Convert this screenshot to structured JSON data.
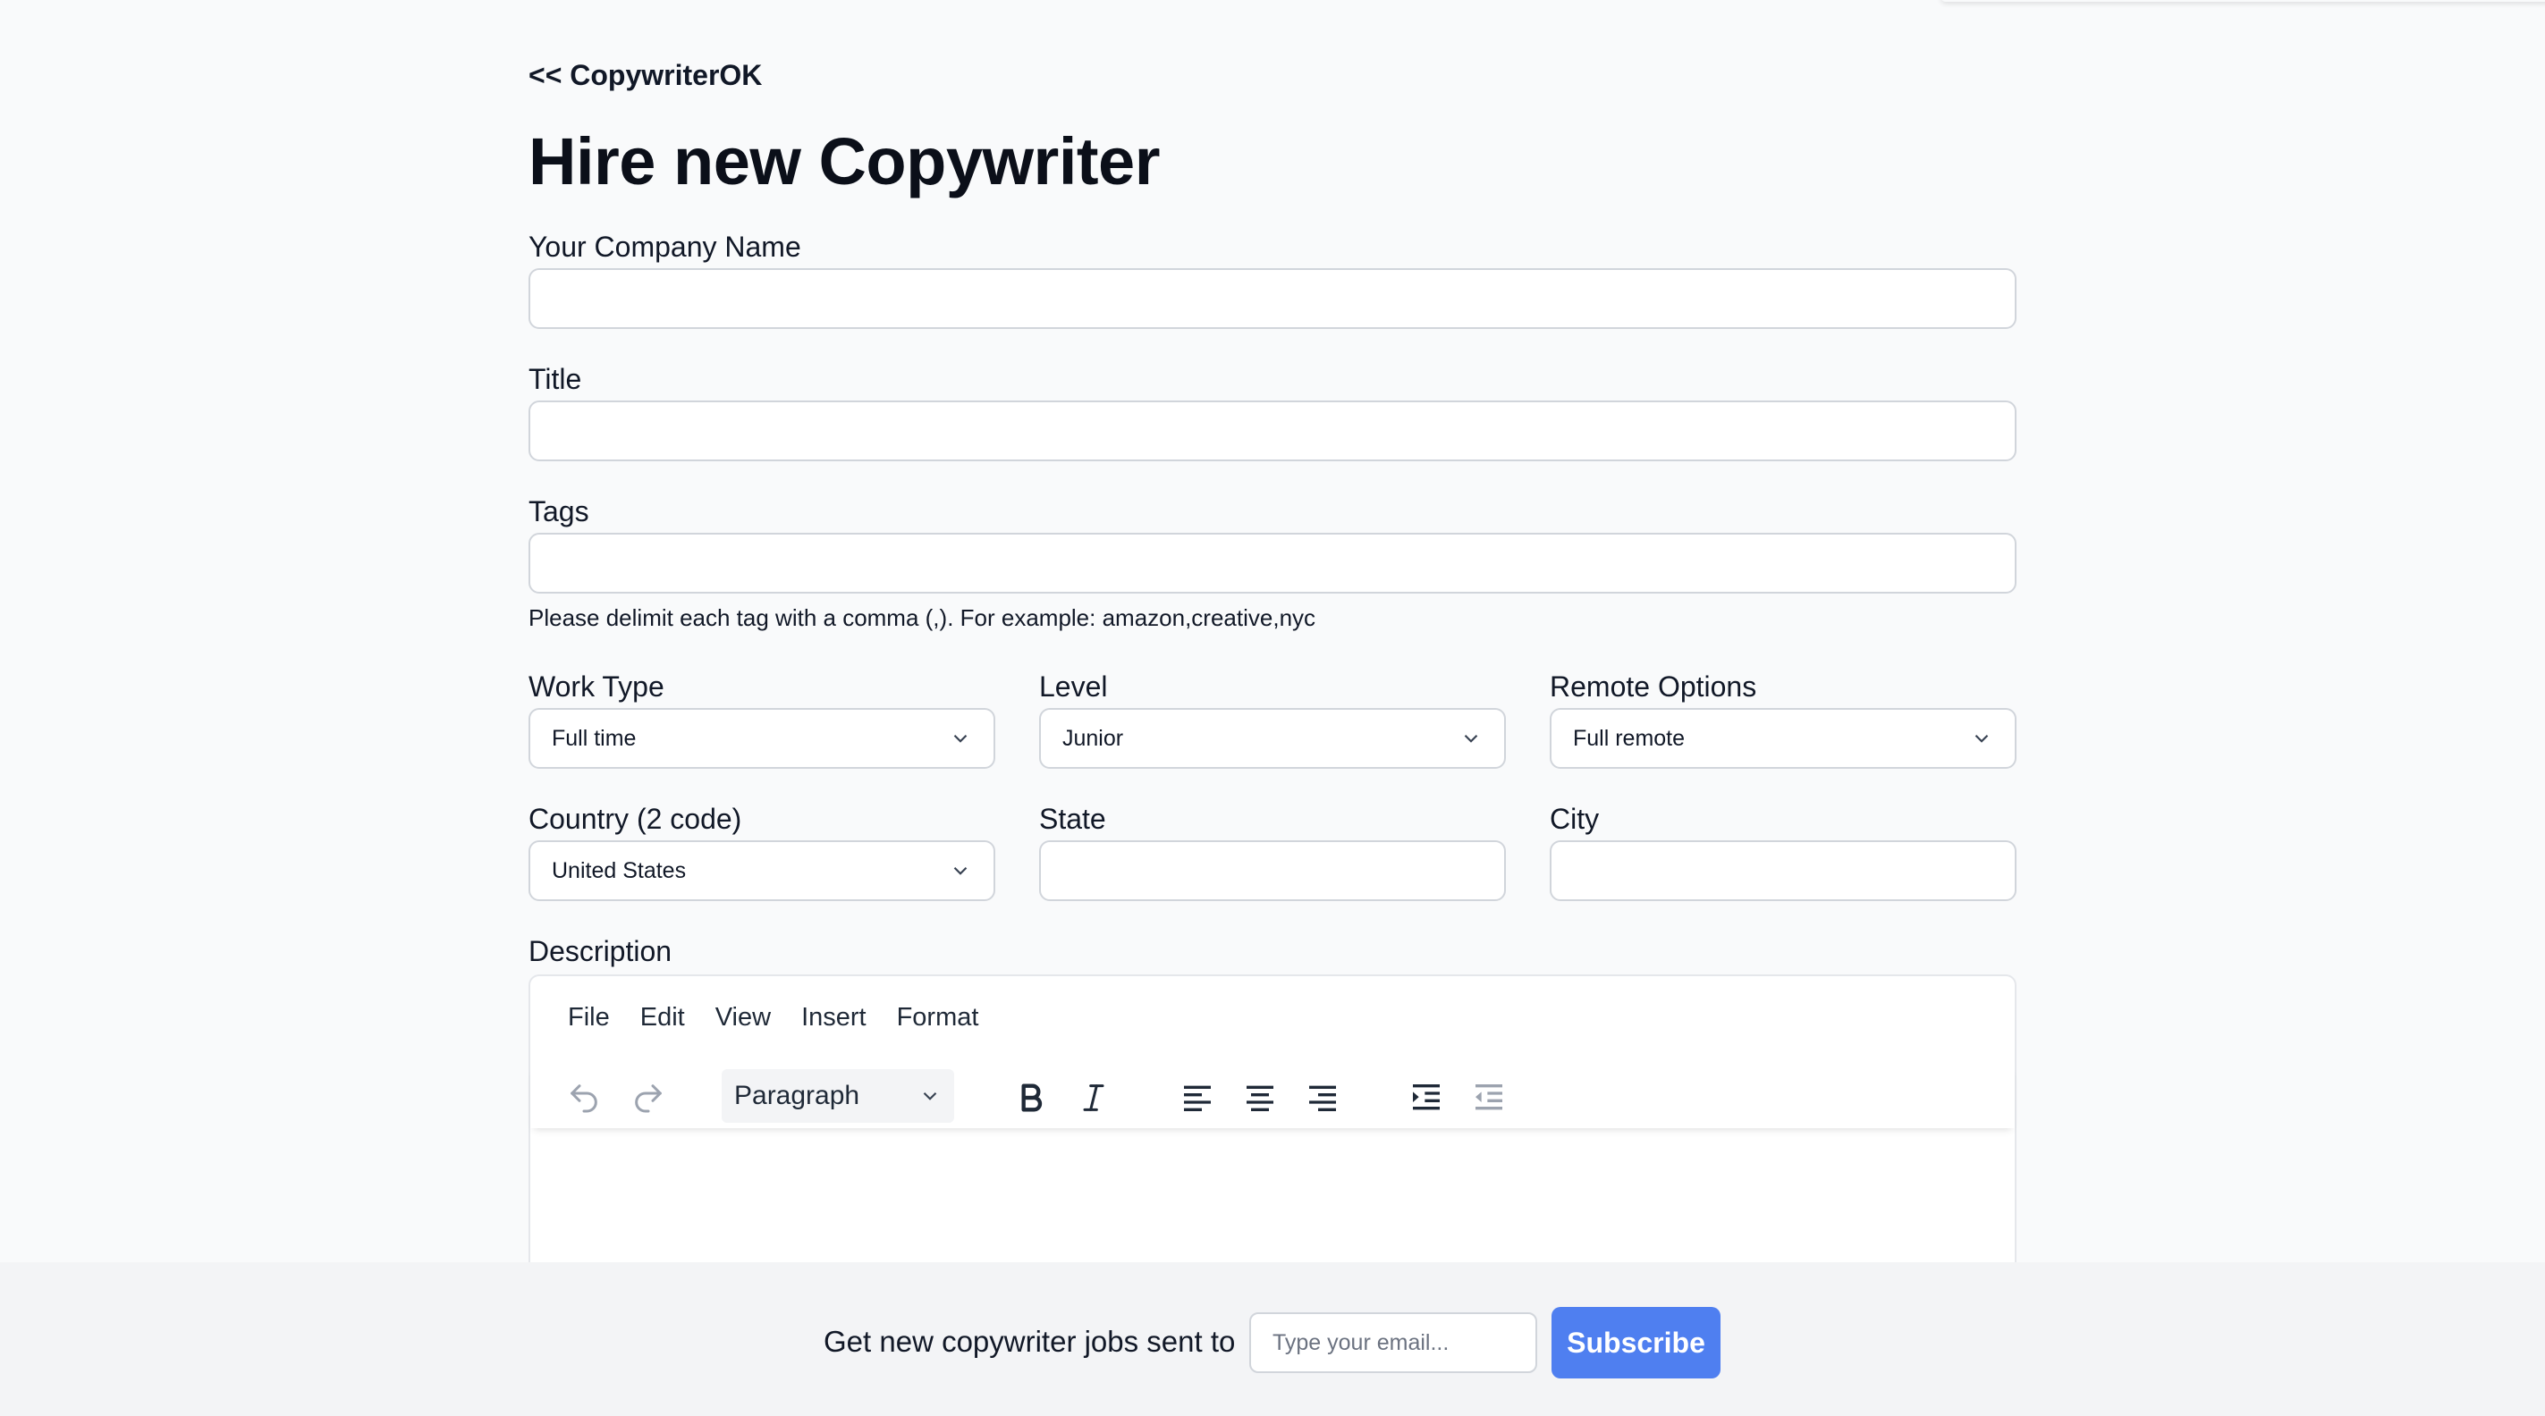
{
  "nav": {
    "back_link": "<< CopywriterOK"
  },
  "page": {
    "title": "Hire new Copywriter"
  },
  "form": {
    "company_name": {
      "label": "Your Company Name",
      "value": ""
    },
    "title": {
      "label": "Title",
      "value": ""
    },
    "tags": {
      "label": "Tags",
      "value": "",
      "hint": "Please delimit each tag with a comma (,). For example: amazon,creative,nyc"
    },
    "work_type": {
      "label": "Work Type",
      "selected": "Full time"
    },
    "level": {
      "label": "Level",
      "selected": "Junior"
    },
    "remote_options": {
      "label": "Remote Options",
      "selected": "Full remote"
    },
    "country": {
      "label": "Country (2 code)",
      "selected": "United States"
    },
    "state": {
      "label": "State",
      "value": ""
    },
    "city": {
      "label": "City",
      "value": ""
    },
    "description": {
      "label": "Description",
      "menu": [
        "File",
        "Edit",
        "View",
        "Insert",
        "Format"
      ],
      "block_format": "Paragraph",
      "toolbar_icons": [
        "undo-icon",
        "redo-icon",
        "bold-icon",
        "italic-icon",
        "align-left-icon",
        "align-center-icon",
        "align-right-icon",
        "indent-icon",
        "outdent-icon"
      ]
    }
  },
  "footer": {
    "text": "Get new copywriter jobs sent to",
    "email_placeholder": "Type your email...",
    "subscribe_label": "Subscribe",
    "subscribe_color": "#4f7ff0"
  }
}
